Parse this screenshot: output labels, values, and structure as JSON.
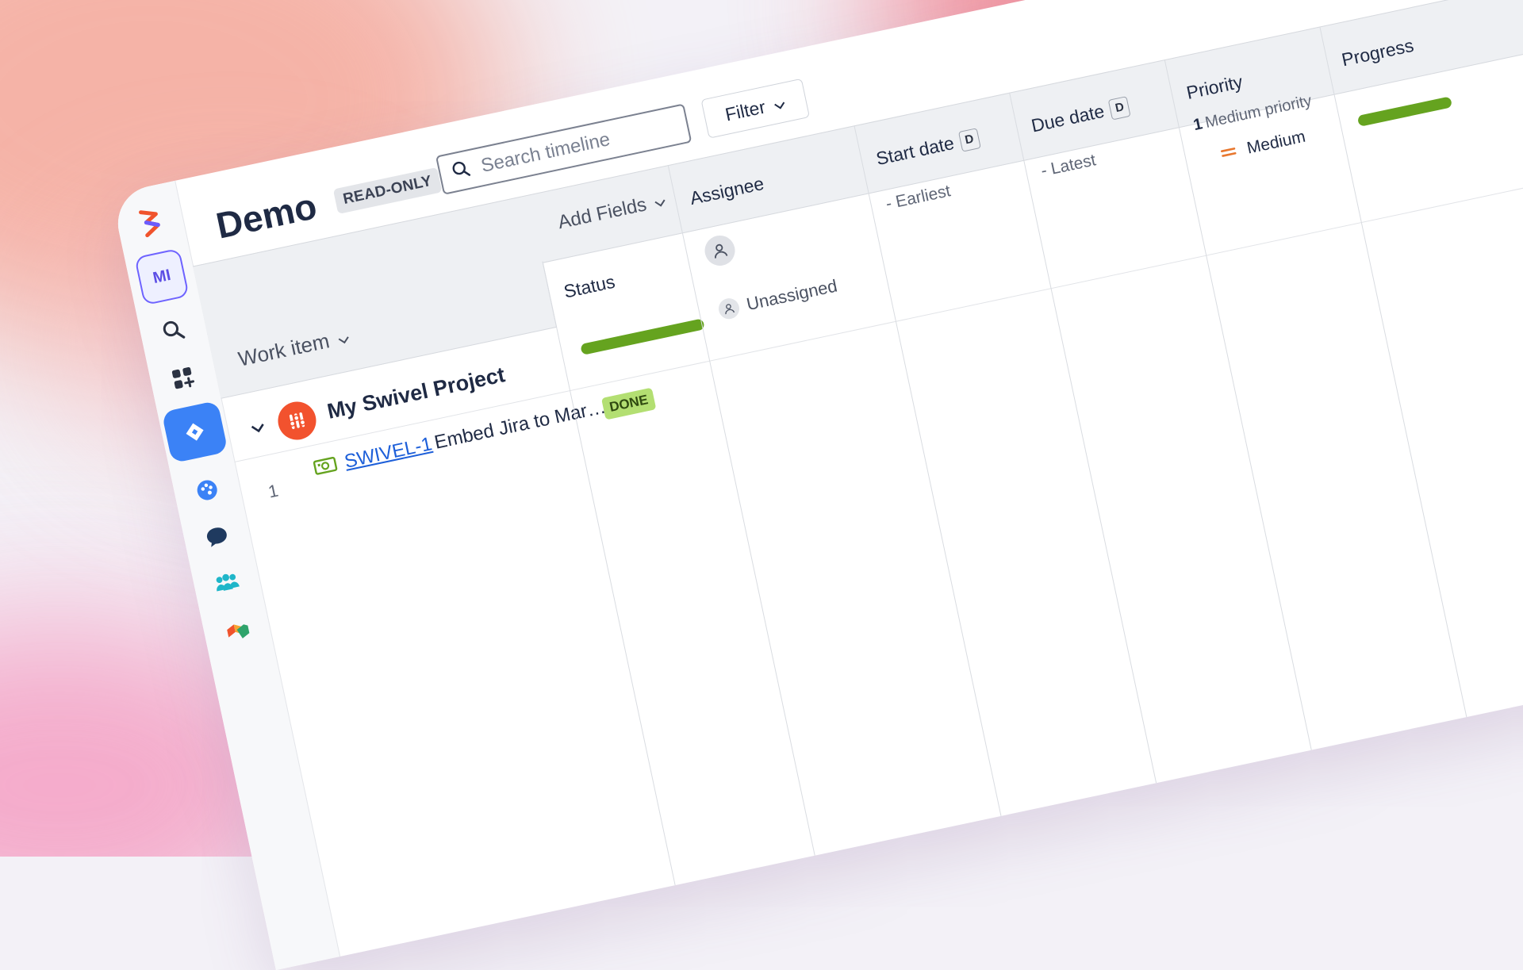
{
  "app": {
    "title": "Demo",
    "mode_badge": "READ-ONLY"
  },
  "search": {
    "placeholder": "Search timeline"
  },
  "toolbar": {
    "filter_label": "Filter",
    "add_fields_label": "Add Fields"
  },
  "sidebar": {
    "user_initials": "MI",
    "icons": [
      "logo-icon",
      "search-icon",
      "apps-add-icon",
      "jira-icon",
      "palette-icon",
      "chat-icon",
      "team-icon",
      "blocks-icon"
    ]
  },
  "table": {
    "work_item_header": "Work item",
    "columns": {
      "status": "Status",
      "assignee": "Assignee",
      "start_date": "Start date",
      "start_date_key": "D",
      "due_date": "Due date",
      "due_date_key": "D",
      "priority": "Priority",
      "progress": "Progress"
    },
    "summary": {
      "start_date": "- Earliest",
      "due_date": "- Latest",
      "priority_count": "1",
      "priority_label": "Medium priority",
      "progress_fraction": 1.0
    },
    "group": {
      "name": "My Swivel Project",
      "status": "DONE",
      "assignee": "Unassigned",
      "priority": "Medium",
      "status_fraction": 1.0
    },
    "rows": [
      {
        "number": "1",
        "key": "SWIVEL-1",
        "summary": "Embed Jira to Marketing"
      }
    ]
  },
  "colors": {
    "accent": "#3b82f6",
    "done_green": "#65a31f",
    "done_badge": "#b3df72",
    "priority_medium": "#e8772e",
    "link": "#1d5fd9"
  }
}
